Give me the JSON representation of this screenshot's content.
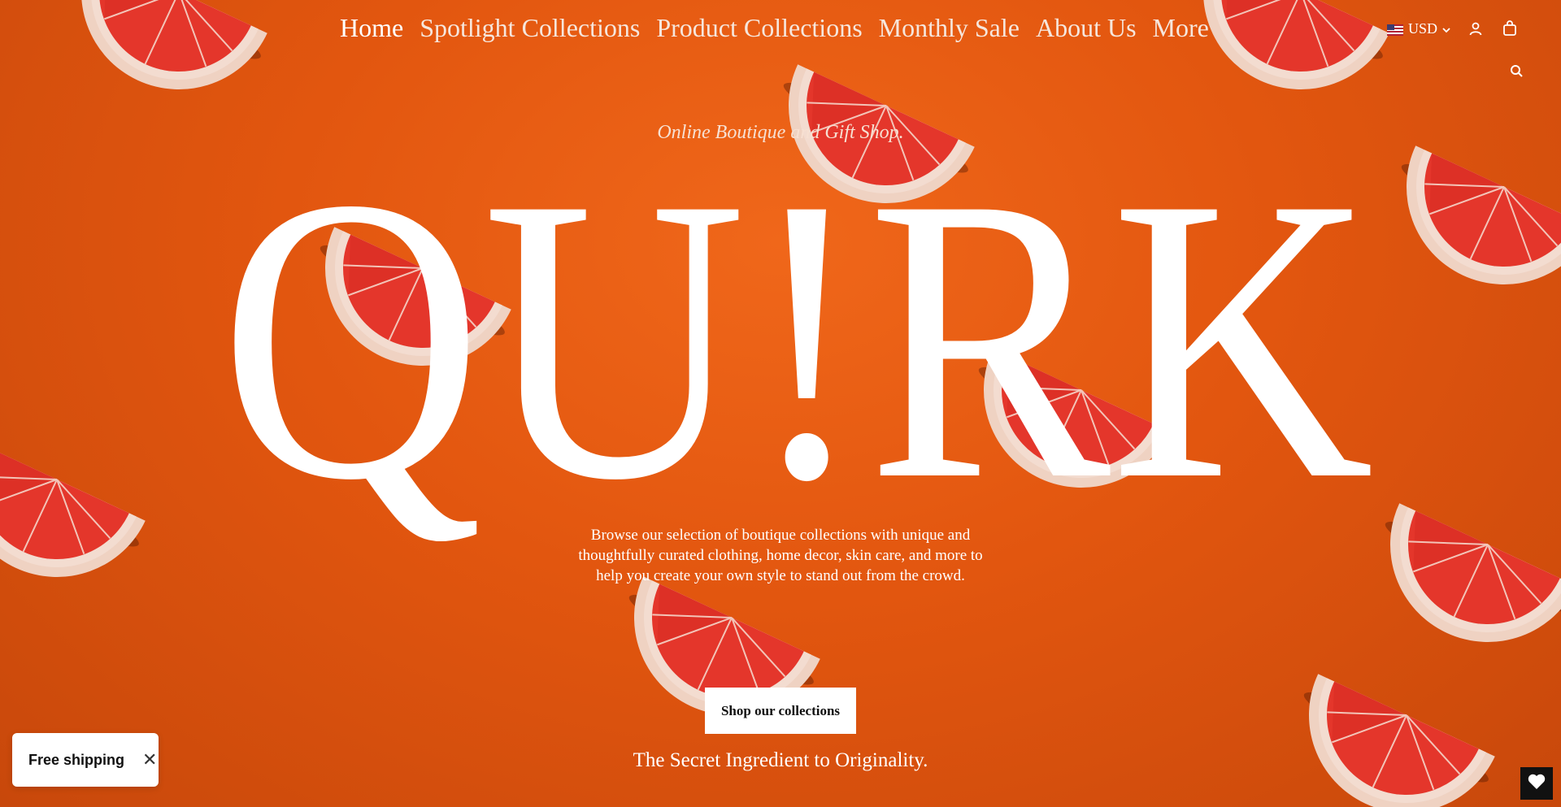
{
  "nav": {
    "items": [
      {
        "label": "Home"
      },
      {
        "label": "Spotlight Collections"
      },
      {
        "label": "Product Collections"
      },
      {
        "label": "Monthly Sale"
      },
      {
        "label": "About Us"
      },
      {
        "label": "More"
      }
    ]
  },
  "header": {
    "currency": "USD",
    "currency_flag": "us-flag-icon",
    "account_icon": "user-icon",
    "cart_icon": "shopping-bag-icon",
    "search_icon": "search-icon"
  },
  "hero": {
    "tagline": "Online Boutique and Gift Shop.",
    "wordmark": "QU!RK",
    "description": "Browse our selection of boutique collections with unique and thoughtfully curated clothing, home decor, skin care, and more to help you create your own style to stand out from the crowd.",
    "cta_label": "Shop our collections",
    "slogan": "The Secret Ingredient to Originality."
  },
  "toast": {
    "label": "Free shipping",
    "close_symbol": "✕"
  },
  "wishlist": {
    "icon": "heart-icon"
  },
  "colors": {
    "background": "#e05a12",
    "text": "#ffffff",
    "button_bg": "#ffffff",
    "button_text": "#111111",
    "fruit_flesh": "#e8322a",
    "fruit_rind": "#f0c9b6"
  }
}
